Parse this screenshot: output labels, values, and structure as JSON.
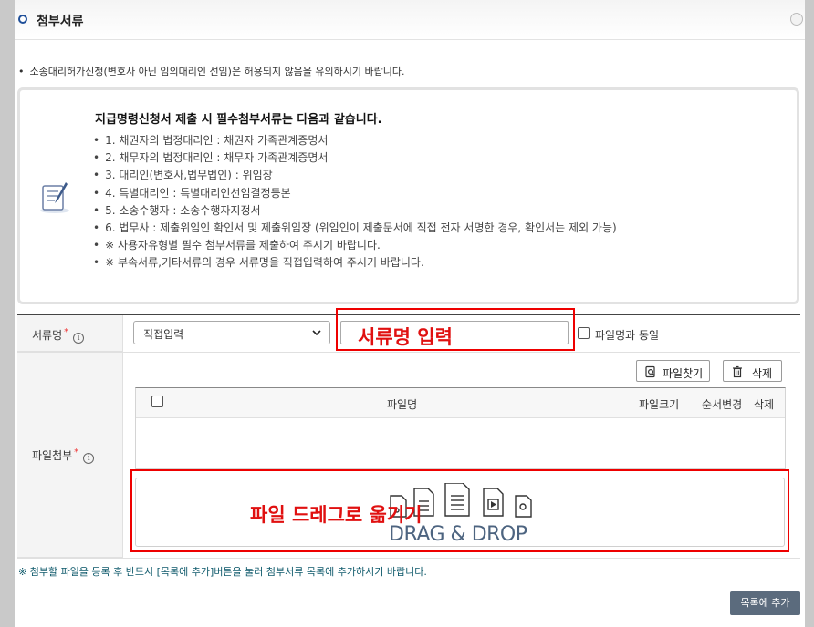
{
  "section_title": "첨부서류",
  "notice": "소송대리허가신청(변호사 아닌 임의대리인 선임)은 허용되지 않음을 유의하시기 바랍니다.",
  "info": {
    "title": "지급명령신청서 제출 시 필수첨부서류는 다음과 같습니다.",
    "bullet": "•",
    "items": [
      "1. 채권자의 법정대리인 : 채권자 가족관계증명서",
      "2. 채무자의 법정대리인 : 채무자 가족관계증명서",
      "3. 대리인(변호사,법무법인) : 위임장",
      "4. 특별대리인 : 특별대리인선임결정등본",
      "5. 소송수행자 : 소송수행자지정서",
      "6. 법무사 : 제출위임인 확인서 및 제출위임장 (위임인이 제출문서에 직접 전자 서명한 경우, 확인서는 제외 가능)",
      "※ 사용자유형별 필수 첨부서류를 제출하여 주시기 바랍니다.",
      "※ 부속서류,기타서류의 경우 서류명을 직접입력하여 주시기 바랍니다."
    ]
  },
  "form": {
    "doc_name_label": "서류명",
    "required_mark": "*",
    "info_mark": "i",
    "select_value": "직접입력",
    "annotation_input": "서류명 입력",
    "same_as_filename_label": "파일명과 동일",
    "file_attach_label": "파일첨부",
    "find_file_button": "파일찾기",
    "delete_button": "삭제",
    "table_headers": {
      "filename": "파일명",
      "filesize": "파일크기",
      "order": "순서변경",
      "delete": "삭제"
    },
    "annotation_drag": "파일 드레그로 옮기기",
    "drag_drop_text": "DRAG & DROP"
  },
  "bottom_note": "※ 첨부할 파일을 등록 후 반드시 [목록에 추가]버튼을 눌러 첨부서류 목록에 추가하시기 바랍니다.",
  "add_to_list_button": "목록에 추가",
  "colors": {
    "accent_blue": "#1f4f99",
    "annotation_red": "#e01010",
    "note_teal": "#0f5a6b",
    "button_slate": "#5b6b7d"
  }
}
